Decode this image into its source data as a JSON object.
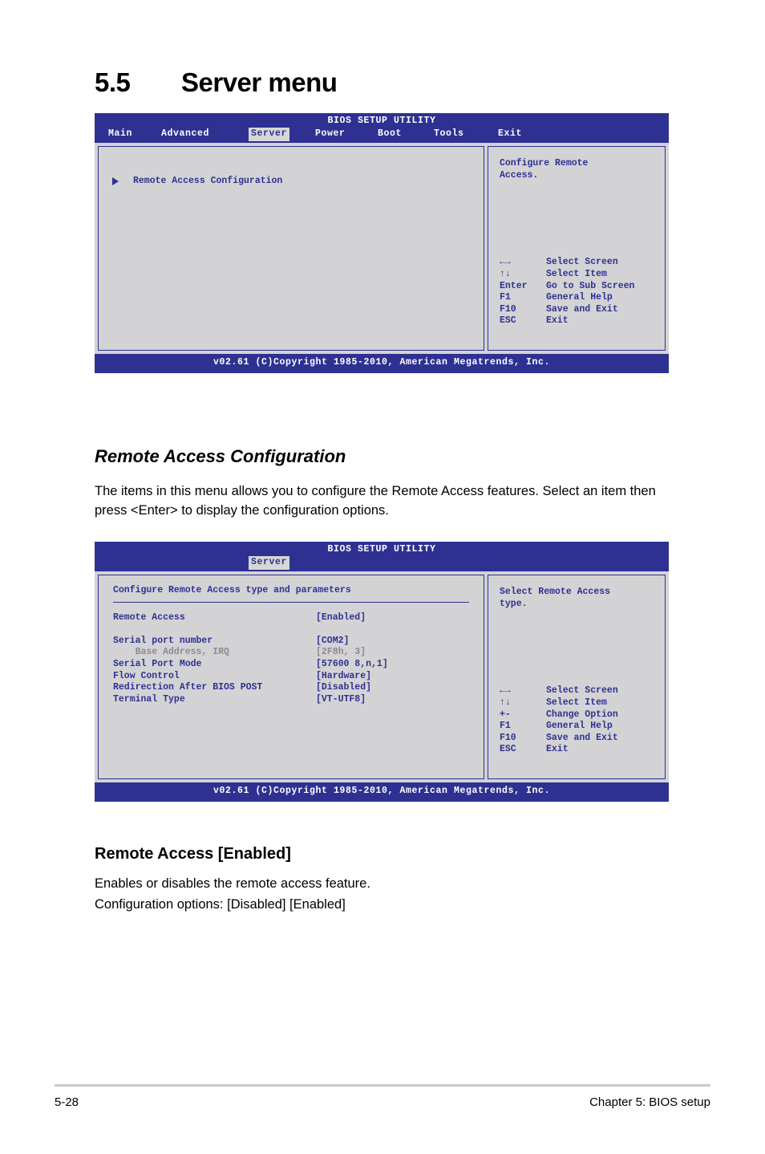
{
  "section": {
    "number": "5.5",
    "title": "Server menu"
  },
  "bios_screen_1": {
    "utility_title": "BIOS SETUP UTILITY",
    "tabs": [
      {
        "label": "Main",
        "active": false
      },
      {
        "label": "Advanced",
        "active": false
      },
      {
        "label": "Server",
        "active": true
      },
      {
        "label": "Power",
        "active": false
      },
      {
        "label": "Boot",
        "active": false
      },
      {
        "label": "Tools",
        "active": false
      },
      {
        "label": "Exit",
        "active": false
      }
    ],
    "submenu_item": "Remote Access Configuration",
    "help_text": "Configure Remote\nAccess.",
    "help_keys": [
      {
        "key": "←→",
        "desc": "Select Screen"
      },
      {
        "key": "↑↓",
        "desc": "Select Item"
      },
      {
        "key": "Enter",
        "desc": "Go to Sub Screen"
      },
      {
        "key": "F1",
        "desc": "General Help"
      },
      {
        "key": "F10",
        "desc": "Save and Exit"
      },
      {
        "key": "ESC",
        "desc": "Exit"
      }
    ],
    "footer": "v02.61 (C)Copyright 1985-2010, American Megatrends, Inc."
  },
  "heading_remote_access_configuration": "Remote Access Configuration",
  "para_remote_access_configuration": "The items in this menu allows you to configure the Remote Access features. Select an item then press <Enter> to display the configuration options.",
  "bios_screen_2": {
    "utility_title": "BIOS SETUP UTILITY",
    "tabs": [
      {
        "label": "Server",
        "active": true
      }
    ],
    "config_title": "Configure Remote Access type and parameters",
    "rows": [
      {
        "label": "Remote Access",
        "value": "[Enabled]",
        "dim": false
      },
      {
        "label": "",
        "value": "",
        "dim": false,
        "blank": true
      },
      {
        "label": "Serial port number",
        "value": "[COM2]",
        "dim": false
      },
      {
        "label": "    Base Address, IRQ",
        "value": "[2F8h, 3]",
        "dim": true
      },
      {
        "label": "Serial Port Mode",
        "value": "[57600 8,n,1]",
        "dim": false
      },
      {
        "label": "Flow Control",
        "value": "[Hardware]",
        "dim": false
      },
      {
        "label": "Redirection After BIOS POST",
        "value": "[Disabled]",
        "dim": false
      },
      {
        "label": "Terminal Type",
        "value": "[VT-UTF8]",
        "dim": false
      }
    ],
    "help_text": "Select Remote Access\ntype.",
    "help_keys": [
      {
        "key": "←→",
        "desc": "Select Screen"
      },
      {
        "key": "↑↓",
        "desc": "Select Item"
      },
      {
        "key": "+-",
        "desc": "Change Option"
      },
      {
        "key": "F1",
        "desc": "General Help"
      },
      {
        "key": "F10",
        "desc": "Save and Exit"
      },
      {
        "key": "ESC",
        "desc": "Exit"
      }
    ],
    "footer": "v02.61 (C)Copyright 1985-2010, American Megatrends, Inc."
  },
  "heading_remote_access": "Remote Access [Enabled]",
  "para_remote_access_line1": "Enables or disables the remote access feature.",
  "para_remote_access_line2": "Configuration options: [Disabled] [Enabled]",
  "page_footer": {
    "left": "5-28",
    "right": "Chapter 5: BIOS setup"
  },
  "colors": {
    "bios_blue": "#2e3192",
    "bios_panel": "#d3d3d5",
    "tab_highlight": "#d6d6d6",
    "dim_text": "#8b8b93"
  }
}
